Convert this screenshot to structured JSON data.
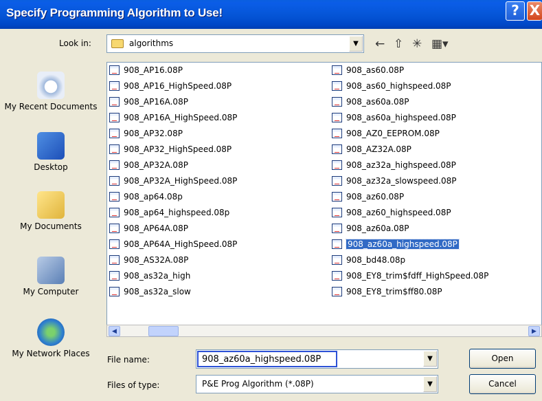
{
  "window": {
    "title": "Specify Programming Algorithm to Use!",
    "help_label": "?",
    "close_label": "X"
  },
  "lookin": {
    "label": "Look in:",
    "value": "algorithms",
    "dropdown_glyph": "▼"
  },
  "toolbar": {
    "back_glyph": "←",
    "up_glyph": "⇧",
    "new_folder_glyph": "✳",
    "view_glyph": "▦▾"
  },
  "places": [
    {
      "label": "My Recent Documents",
      "icon": "recent-documents-icon"
    },
    {
      "label": "Desktop",
      "icon": "desktop-icon"
    },
    {
      "label": "My Documents",
      "icon": "my-documents-icon"
    },
    {
      "label": "My Computer",
      "icon": "my-computer-icon"
    },
    {
      "label": "My Network Places",
      "icon": "network-places-icon"
    }
  ],
  "files_col1": [
    "908_AP16.08P",
    "908_AP16_HighSpeed.08P",
    "908_AP16A.08P",
    "908_AP16A_HighSpeed.08P",
    "908_AP32.08P",
    "908_AP32_HighSpeed.08P",
    "908_AP32A.08P",
    "908_AP32A_HighSpeed.08P",
    "908_ap64.08p",
    "908_ap64_highspeed.08p",
    "908_AP64A.08P",
    "908_AP64A_HighSpeed.08P",
    "908_AS32A.08P",
    "908_as32a_high",
    "908_as32a_slow"
  ],
  "files_col2": [
    "908_as60.08P",
    "908_as60_highspeed.08P",
    "908_as60a.08P",
    "908_as60a_highspeed.08P",
    "908_AZ0_EEPROM.08P",
    "908_AZ32A.08P",
    "908_az32a_highspeed.08P",
    "908_az32a_slowspeed.08P",
    "908_az60.08P",
    "908_az60_highspeed.08P",
    "908_az60a.08P",
    "908_az60a_highspeed.08P",
    "908_bd48.08p",
    "908_EY8_trim$fdff_HighSpeed.08P",
    "908_EY8_trim$ff80.08P"
  ],
  "selected_file": "908_az60a_highspeed.08P",
  "scroll": {
    "left": "◀",
    "right": "▶"
  },
  "file_name": {
    "label": "File name:",
    "value": "908_az60a_highspeed.08P"
  },
  "file_type": {
    "label": "Files of type:",
    "value": "P&E Prog Algorithm (*.08P)"
  },
  "buttons": {
    "open": "Open",
    "cancel": "Cancel"
  }
}
